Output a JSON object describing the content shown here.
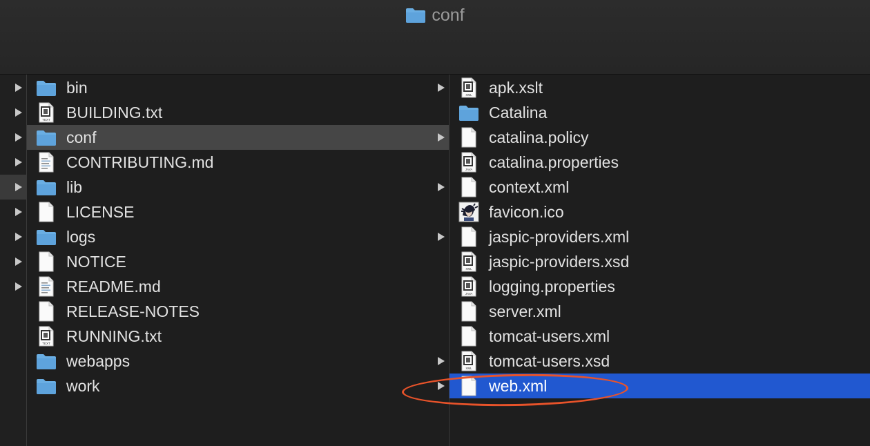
{
  "window": {
    "title": "conf"
  },
  "column1": {
    "items": [
      {
        "name": "bin",
        "type": "folder",
        "has_children": true
      },
      {
        "name": "BUILDING.txt",
        "type": "text"
      },
      {
        "name": "conf",
        "type": "folder",
        "has_children": true,
        "selected": true
      },
      {
        "name": "CONTRIBUTING.md",
        "type": "markdown"
      },
      {
        "name": "lib",
        "type": "folder",
        "has_children": true
      },
      {
        "name": "LICENSE",
        "type": "blank"
      },
      {
        "name": "logs",
        "type": "folder",
        "has_children": true
      },
      {
        "name": "NOTICE",
        "type": "blank"
      },
      {
        "name": "README.md",
        "type": "markdown"
      },
      {
        "name": "RELEASE-NOTES",
        "type": "blank"
      },
      {
        "name": "RUNNING.txt",
        "type": "text"
      },
      {
        "name": "webapps",
        "type": "folder",
        "has_children": true
      },
      {
        "name": "work",
        "type": "folder",
        "has_children": true
      }
    ]
  },
  "column2": {
    "items": [
      {
        "name": "apk.xslt",
        "type": "xml"
      },
      {
        "name": "Catalina",
        "type": "folder"
      },
      {
        "name": "catalina.policy",
        "type": "blank"
      },
      {
        "name": "catalina.properties",
        "type": "java"
      },
      {
        "name": "context.xml",
        "type": "blank"
      },
      {
        "name": "favicon.ico",
        "type": "image"
      },
      {
        "name": "jaspic-providers.xml",
        "type": "blank"
      },
      {
        "name": "jaspic-providers.xsd",
        "type": "xml"
      },
      {
        "name": "logging.properties",
        "type": "java"
      },
      {
        "name": "server.xml",
        "type": "blank"
      },
      {
        "name": "tomcat-users.xml",
        "type": "blank"
      },
      {
        "name": "tomcat-users.xsd",
        "type": "xml"
      },
      {
        "name": "web.xml",
        "type": "blank",
        "selected": true
      }
    ]
  },
  "icon_badges": {
    "text": "TEXT",
    "xml": "XML",
    "java": "JAVA"
  },
  "colors": {
    "folder": "#6aaee3",
    "selection_blue": "#2158d0",
    "selection_grey": "#464646",
    "annotation": "#e8532a"
  },
  "annotation": {
    "shape": "ellipse",
    "target": "web.xml"
  }
}
